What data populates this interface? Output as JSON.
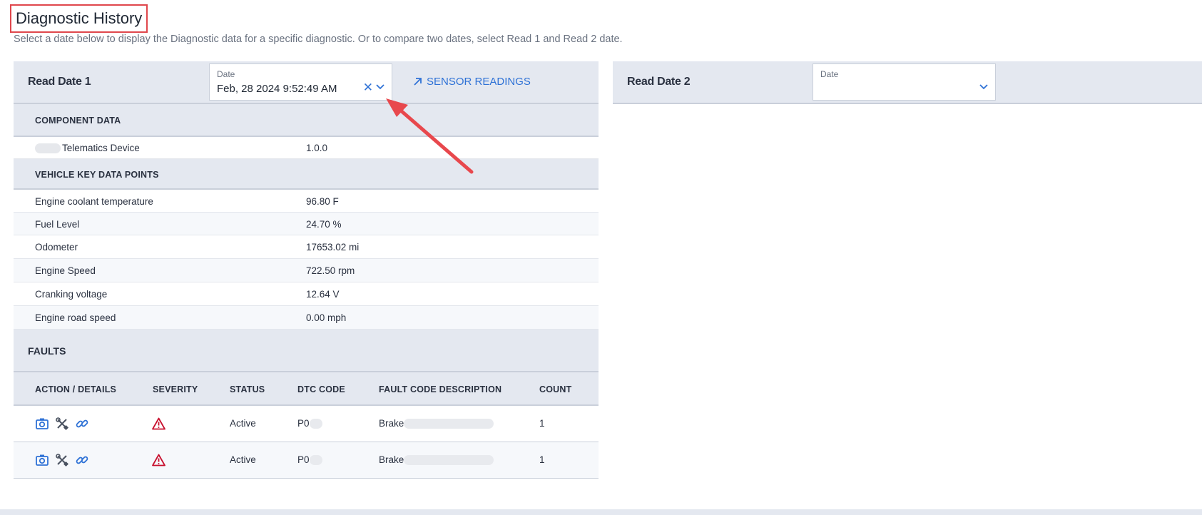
{
  "page": {
    "title": "Diagnostic History",
    "subtitle": "Select a date below to display the Diagnostic data for a specific diagnostic. Or to compare two dates, select Read 1 and Read 2 date."
  },
  "read1": {
    "title": "Read Date 1",
    "date_label": "Date",
    "date_value": "Feb, 28 2024 9:52:49 AM",
    "clear_glyph": "✕",
    "sensor_link": "SENSOR READINGS"
  },
  "read2": {
    "title": "Read Date 2",
    "date_label": "Date",
    "date_value": ""
  },
  "component_data": {
    "header": "COMPONENT DATA",
    "rows": [
      {
        "key": "Telematics Device",
        "value": "1.0.0"
      }
    ]
  },
  "vehicle_key": {
    "header": "VEHICLE KEY DATA POINTS",
    "rows": [
      {
        "key": "Engine coolant temperature",
        "value": "96.80 F"
      },
      {
        "key": "Fuel Level",
        "value": "24.70 %"
      },
      {
        "key": "Odometer",
        "value": "17653.02 mi"
      },
      {
        "key": "Engine Speed",
        "value": "722.50 rpm"
      },
      {
        "key": "Cranking voltage",
        "value": "12.64 V"
      },
      {
        "key": "Engine road speed",
        "value": "0.00 mph"
      }
    ]
  },
  "faults": {
    "header": "FAULTS",
    "columns": [
      "ACTION / DETAILS",
      "SEVERITY",
      "STATUS",
      "DTC CODE",
      "FAULT CODE DESCRIPTION",
      "COUNT"
    ],
    "rows": [
      {
        "status": "Active",
        "dtc": "P0",
        "description": "Brake",
        "count": "1",
        "severity_icon": "warning-triangle-icon"
      },
      {
        "status": "Active",
        "dtc": "P0",
        "description": "Brake",
        "count": "1",
        "severity_icon": "warning-triangle-icon"
      }
    ]
  },
  "colors": {
    "accent": "#2f72d6",
    "header_bg": "#e4e8f0",
    "highlight": "#e0474c",
    "severity": "#c8102e"
  },
  "icons": [
    "camera-icon",
    "tools-icon",
    "link-icon",
    "warning-triangle-icon",
    "chevron-down-icon",
    "arrow-up-right-icon",
    "close-icon"
  ]
}
